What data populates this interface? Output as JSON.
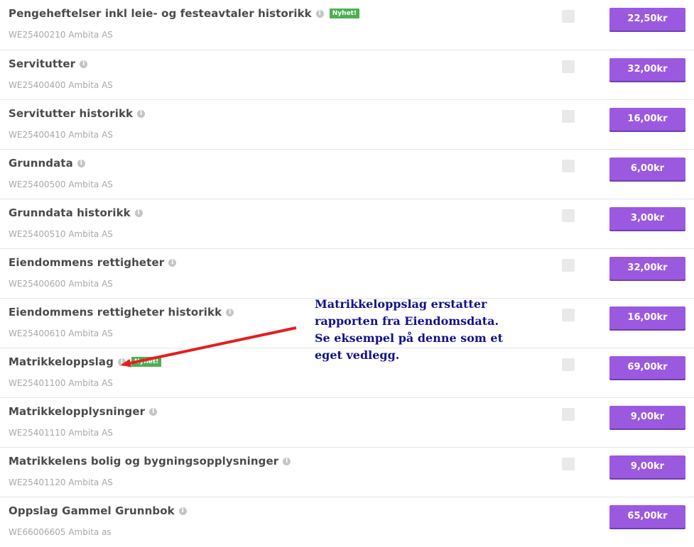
{
  "products": [
    {
      "title": "Pengeheftelser inkl leie- og festeavtaler historikk",
      "subtitle": "WE25400210 Ambita AS",
      "price": "22,50kr",
      "badge": "Nyhet!",
      "checkbox": true
    },
    {
      "title": "Servitutter",
      "subtitle": "WE25400400 Ambita AS",
      "price": "32,00kr",
      "badge": "",
      "checkbox": true
    },
    {
      "title": "Servitutter historikk",
      "subtitle": "WE25400410 Ambita AS",
      "price": "16,00kr",
      "badge": "",
      "checkbox": true
    },
    {
      "title": "Grunndata",
      "subtitle": "WE25400500 Ambita AS",
      "price": "6,00kr",
      "badge": "",
      "checkbox": true
    },
    {
      "title": "Grunndata historikk",
      "subtitle": "WE25400510 Ambita AS",
      "price": "3,00kr",
      "badge": "",
      "checkbox": true
    },
    {
      "title": "Eiendommens rettigheter",
      "subtitle": "WE25400600 Ambita AS",
      "price": "32,00kr",
      "badge": "",
      "checkbox": true
    },
    {
      "title": "Eiendommens rettigheter historikk",
      "subtitle": "WE25400610 Ambita AS",
      "price": "16,00kr",
      "badge": "",
      "checkbox": true
    },
    {
      "title": "Matrikkeloppslag",
      "subtitle": "WE25401100 Ambita AS",
      "price": "69,00kr",
      "badge": "Nyhet!",
      "checkbox": true
    },
    {
      "title": "Matrikkelopplysninger",
      "subtitle": "WE25401110 Ambita AS",
      "price": "9,00kr",
      "badge": "",
      "checkbox": true
    },
    {
      "title": "Matrikkelens bolig og bygningsopplysninger",
      "subtitle": "WE25401120 Ambita AS",
      "price": "9,00kr",
      "badge": "",
      "checkbox": true
    },
    {
      "title": "Oppslag Gammel Grunnbok",
      "subtitle": "WE66006605 Ambita as",
      "price": "65,00kr",
      "badge": "",
      "checkbox": false
    }
  ],
  "annotation": {
    "lines": [
      "Matrikkeloppslag erstatter",
      "rapporten fra Eiendomsdata.",
      "Se eksempel på denne som et",
      "eget vedlegg."
    ],
    "color": "#12128a"
  },
  "colors": {
    "price_button": "#9b59e0",
    "badge": "#4caf50",
    "arrow": "#e51e1e"
  },
  "icons": {
    "info": "info-icon"
  }
}
